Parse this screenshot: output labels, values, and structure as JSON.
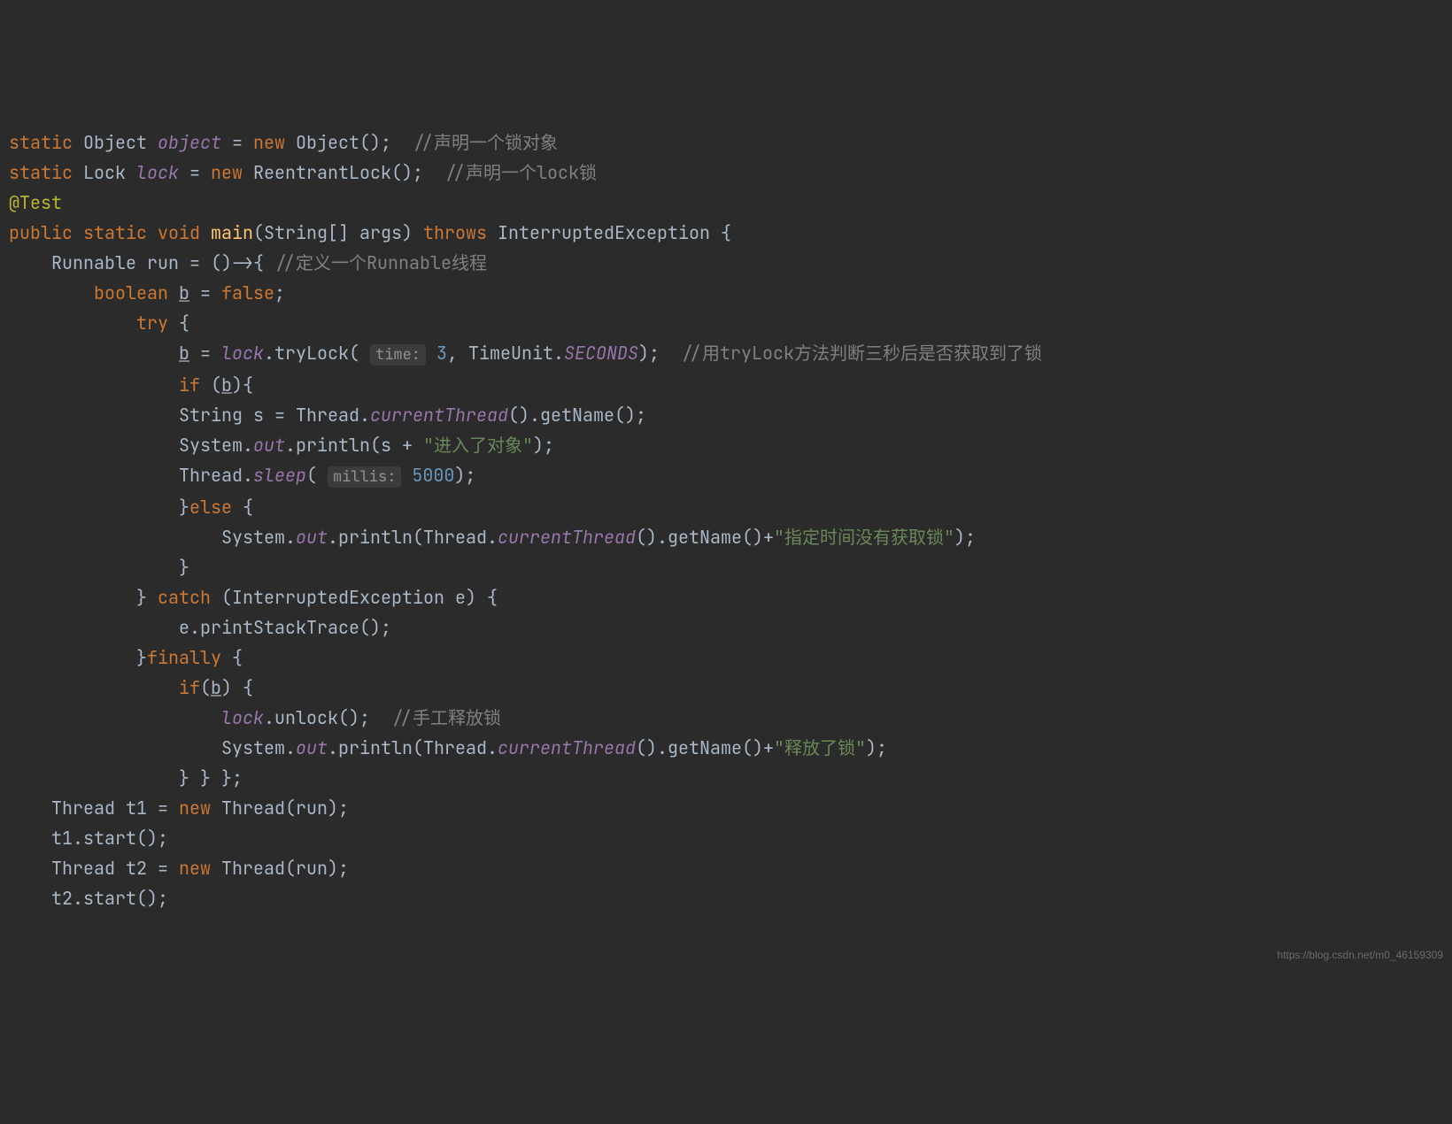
{
  "lines": {
    "l1_kw1": "static",
    "l1_type": "Object",
    "l1_field": "object",
    "l1_eq": " = ",
    "l1_kw2": "new",
    "l1_ctor": " Object();  ",
    "l1_cmt": "//声明一个锁对象",
    "l2_kw1": "static",
    "l2_type": "Lock",
    "l2_field": "lock",
    "l2_eq": " = ",
    "l2_kw2": "new",
    "l2_ctor": " ReentrantLock();  ",
    "l2_cmt": "//声明一个lock锁",
    "l3": "@Test",
    "l4_kw1": "public static void",
    "l4_method": "main",
    "l4_params": "(String[] args) ",
    "l4_throws": "throws",
    "l4_exc": " InterruptedException {",
    "l5_pre": "    Runnable run = ()->{ ",
    "l5_cmt": "//定义一个Runnable线程",
    "l6_pre": "        ",
    "l6_kw": "boolean",
    "l6_b": "b",
    "l6_rest": " = ",
    "l6_false": "false",
    "l6_semi": ";",
    "l7_pre": "            ",
    "l7_try": "try",
    "l7_brace": " {",
    "l8_pre": "                ",
    "l8_b": "b",
    "l8_rest1": " = ",
    "l8_lock": "lock",
    "l8_rest2": ".tryLock( ",
    "l8_hint1": "time:",
    "l8_num1": " 3",
    "l8_rest3": ", TimeUnit.",
    "l8_sec": "SECONDS",
    "l8_rest4": ");  ",
    "l8_cmt": "//用tryLock方法判断三秒后是否获取到了锁",
    "l9_pre": "                ",
    "l9_if": "if",
    "l9_rest": " (",
    "l9_b": "b",
    "l9_brace": "){",
    "l10_pre": "                String s = Thread.",
    "l10_m": "currentThread",
    "l10_rest": "().getName();",
    "l11_pre": "                System.",
    "l11_out": "out",
    "l11_rest": ".println(s + ",
    "l11_str": "\"进入了对象\"",
    "l11_end": ");",
    "l12_pre": "                Thread.",
    "l12_sleep": "sleep",
    "l12_rest1": "( ",
    "l12_hint": "millis:",
    "l12_num": " 5000",
    "l12_end": ");",
    "l13_pre": "                }",
    "l13_else": "else",
    "l13_brace": " {",
    "l14_pre": "                    System.",
    "l14_out": "out",
    "l14_rest": ".println(Thread.",
    "l14_m": "currentThread",
    "l14_rest2": "().getName()+",
    "l14_str": "\"指定时间没有获取锁\"",
    "l14_end": ");",
    "l15": "                }",
    "l16_pre": "            } ",
    "l16_catch": "catch",
    "l16_rest": " (InterruptedException e) {",
    "l17": "                e.printStackTrace();",
    "l18_pre": "            }",
    "l18_fin": "finally",
    "l18_brace": " {",
    "l19_pre": "                ",
    "l19_if": "if",
    "l19_rest": "(",
    "l19_b": "b",
    "l19_brace": ") {",
    "l20_pre": "                    ",
    "l20_lock": "lock",
    "l20_rest": ".unlock();  ",
    "l20_cmt": "//手工释放锁",
    "l21_pre": "                    System.",
    "l21_out": "out",
    "l21_rest": ".println(Thread.",
    "l21_m": "currentThread",
    "l21_rest2": "().getName()+",
    "l21_str": "\"释放了锁\"",
    "l21_end": ");",
    "l22": "                } } };",
    "l23_pre": "    Thread t1 = ",
    "l23_new": "new",
    "l23_rest": " Thread(run);",
    "l24": "    t1.start();",
    "l25_pre": "    Thread t2 = ",
    "l25_new": "new",
    "l25_rest": " Thread(run);",
    "l26": "    t2.start();"
  },
  "watermark": "https://blog.csdn.net/m0_46159309"
}
